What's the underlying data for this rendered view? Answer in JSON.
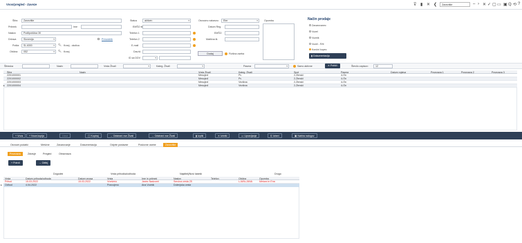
{
  "window": {
    "title": "Vnos/pregled - Zaveze",
    "zoom_value": "Zavezište"
  },
  "toolbar_icons": [
    "filter-icon",
    "trash-icon",
    "close-icon",
    "back-icon",
    "first-icon",
    "prev-icon",
    "next-icon",
    "last-icon",
    "check-icon",
    "copy-icon",
    "window-icon",
    "print-icon",
    "zoom-icon",
    "user-icon",
    "refresh-icon",
    "help-icon"
  ],
  "form": {
    "ime_label": "Šifra",
    "ime_value": "Zavezište",
    "priimek_label": "Priimek",
    "priimek_value": "",
    "ime2_label": "Ime",
    "ime2_value": "",
    "naslov_label": "Naslov",
    "naslov_value": "Podlipoščica 30",
    "drzava_label": "Država",
    "drzava_value": "Slovenija",
    "prevod_label": "Prevodnik",
    "posta_label": "Pošta",
    "posta_value": "SI-4000",
    "posta_name": "Kranj - okolica",
    "obcina_label": "Občina",
    "obcina_value": "052",
    "obcina_name": "Kranj",
    "status_label": "Status",
    "status_value": "aktiven",
    "emso_label": "EMŠO št.",
    "telefon_label": "Telefon 1",
    "telefon2_label": "Telefon 2",
    "email_label": "E-mail",
    "davcna_label": "Dav.št.",
    "ident_label": "ID za DDV",
    "nacin_label": "Osnovno nabavno",
    "nacin_value": "Eter",
    "datum_label": "Datum Reg.",
    "embo_label": "EMŠO",
    "maticna_label": "Matična št.",
    "opomba_label": "Opomba",
    "btn_dodaj": "Dodaj",
    "fizicna_label": "Fizična oseba"
  },
  "nacin": {
    "title": "Način prodaje",
    "options": [
      "Zavarovanec",
      "Vozel",
      "Voznik",
      "Vozel - R/ti",
      "Končni kupec"
    ],
    "btn": "Dokumentacija"
  },
  "filter": {
    "sifra": "Šifravka",
    "naziv": "Naziv",
    "vrsta": "Vrsta Živali",
    "kateg": "Kateg. Živali",
    "pasma": "Pasma",
    "samo_aktivne": "Samo aktivne",
    "btn_poisci": "Poišči",
    "stevilo_label": "Število zapisov:",
    "stevilo_value": "12"
  },
  "grid1": {
    "headers": [
      "Šifra",
      "Naziv",
      "Vrsta Živali",
      "Kateg. Živali",
      "Spol",
      "Pasma",
      "Datum rojstva",
      "Povezava 1",
      "Povezava 2",
      "Povezava 3"
    ],
    "rows": [
      [
        "2201000001",
        "",
        "Mesojedi",
        "Pv",
        "2-Ženski",
        "4-Ôn"
      ],
      [
        "2201000002",
        "",
        "Mesojedi",
        "Pv",
        "2-Ženski",
        "4-Ôn"
      ],
      [
        "2201000003",
        "",
        "Mesojedi",
        "Vezikna",
        "2-Ženski",
        "4-Ôn"
      ],
      [
        "2201000004",
        "",
        "Mesojedi",
        "Vezikna",
        "2-Ženski",
        "4-Ôn"
      ]
    ]
  },
  "actions": [
    "Vnos",
    "Nova kopija",
    "Uvoz",
    "Kopiraj",
    "Odstrani vse Živali",
    "Odstrani vse Živali",
    "Izpiši",
    "Izbriši",
    "Upravljanje",
    "Izberi",
    "Nabira nalogov"
  ],
  "tabs": [
    "Osnovni podatki",
    "Meščne",
    "Zavarovanje",
    "Dokumentacija",
    "Odprte postavke",
    "Poslovne osebe",
    "Zavezište"
  ],
  "subtabs": [
    "Povezava",
    "Zdravje",
    "Pregled",
    "Obravnava"
  ],
  "btn_potrdi": "Potrdi",
  "btn_odbij": "Odbij",
  "grid2": {
    "group_headers": [
      "Dogodek",
      "Vrsta prihodka/odhoda",
      "Najditelj/Novi lastnik",
      "Drugo"
    ],
    "headers": [
      "Vrsta",
      "Datum prihoda/odhoda",
      "Datum vnosa",
      "Vrsta",
      "Ime in priimek",
      "Naslov",
      "Telefon",
      "Občina",
      "Opomba"
    ],
    "rows": [
      [
        "Prihod",
        "15.03.2022",
        "15.03.2022",
        "Vnešeno",
        "Janez Nadzorni",
        "Senčna cesta 25",
        "",
        "LJUBLJANA",
        "Mešani in Ena"
      ],
      [
        "Odhod",
        "4.04.2022",
        "",
        "Posvojeno",
        "Ana Vodnik",
        "Dolenjska cesta",
        "",
        "",
        ""
      ]
    ]
  }
}
